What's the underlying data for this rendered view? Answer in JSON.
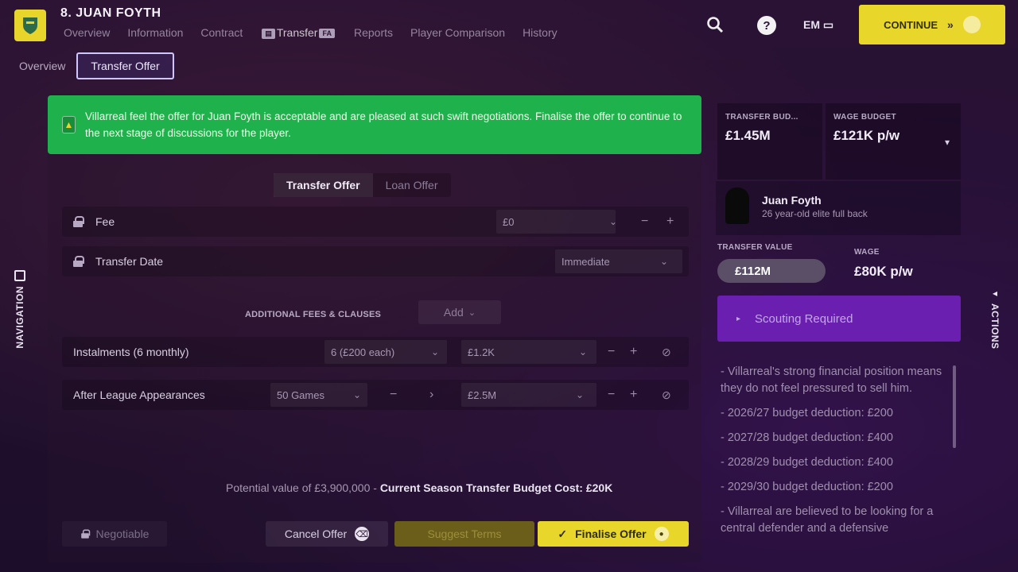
{
  "header": {
    "player_name": "8. JUAN FOYTH",
    "tabs": [
      {
        "label": "Overview",
        "badge": ""
      },
      {
        "label": "Information",
        "badge": ""
      },
      {
        "label": "Contract",
        "badge": ""
      },
      {
        "label": "Transfer",
        "badge": "FA"
      },
      {
        "label": "Reports",
        "badge": ""
      },
      {
        "label": "Player Comparison",
        "badge": ""
      },
      {
        "label": "History",
        "badge": ""
      }
    ],
    "subtabs": [
      "Overview",
      "Transfer Offer"
    ],
    "help_label": "?",
    "user_code": "EM ▭",
    "continue_label": "CONTINUE",
    "continue_arrows": "»"
  },
  "alert": {
    "text": "Villarreal feel the offer for Juan Foyth is acceptable and are pleased at such swift negotiations. Finalise the offer to continue to the next stage of discussions for the player."
  },
  "offer_type": {
    "active": "Transfer Offer",
    "inactive": "Loan Offer"
  },
  "fee": {
    "label": "Fee",
    "value": "£0"
  },
  "transfer_date": {
    "label": "Transfer Date",
    "value": "Immediate"
  },
  "additional": {
    "label": "ADDITIONAL FEES & CLAUSES",
    "add_label": "Add"
  },
  "instalments": {
    "label": "Instalments (6 monthly)",
    "count_value": "6 (£200 each)",
    "amount_value": "£1.2K"
  },
  "appearances": {
    "label": "After League Appearances",
    "games_value": "50 Games",
    "amount_value": "£2.5M"
  },
  "footer": {
    "potential_text": "Potential value of £3,900,000 -",
    "budget_cost_text": "Current Season Transfer Budget Cost: £20K",
    "negotiable_label": "Negotiable",
    "cancel_label": "Cancel Offer",
    "suggest_label": "Suggest Terms",
    "finalise_label": "Finalise Offer"
  },
  "right_panel": {
    "transfer_budget_label": "TRANSFER BUD...",
    "transfer_budget_value": "£1.45M",
    "wage_budget_label": "WAGE BUDGET",
    "wage_budget_value": "£121K p/w",
    "player_name": "Juan Foyth",
    "player_desc": "26 year-old elite full back",
    "transfer_value_label": "TRANSFER VALUE",
    "transfer_value": "£112M",
    "wage_label": "WAGE",
    "wage_value": "£80K p/w",
    "scouting_label": "Scouting Required",
    "notes": [
      "- Villarreal's strong financial position means they do not feel pressured to sell him.",
      "- 2026/27 budget deduction: £200",
      "- 2027/28 budget deduction: £400",
      "- 2028/29 budget deduction: £400",
      "- 2029/30 budget deduction: £200",
      "- Villarreal are believed to be looking for a central defender and a defensive"
    ]
  },
  "side_labels": {
    "navigation": "NAVIGATION",
    "actions": "ACTIONS"
  }
}
